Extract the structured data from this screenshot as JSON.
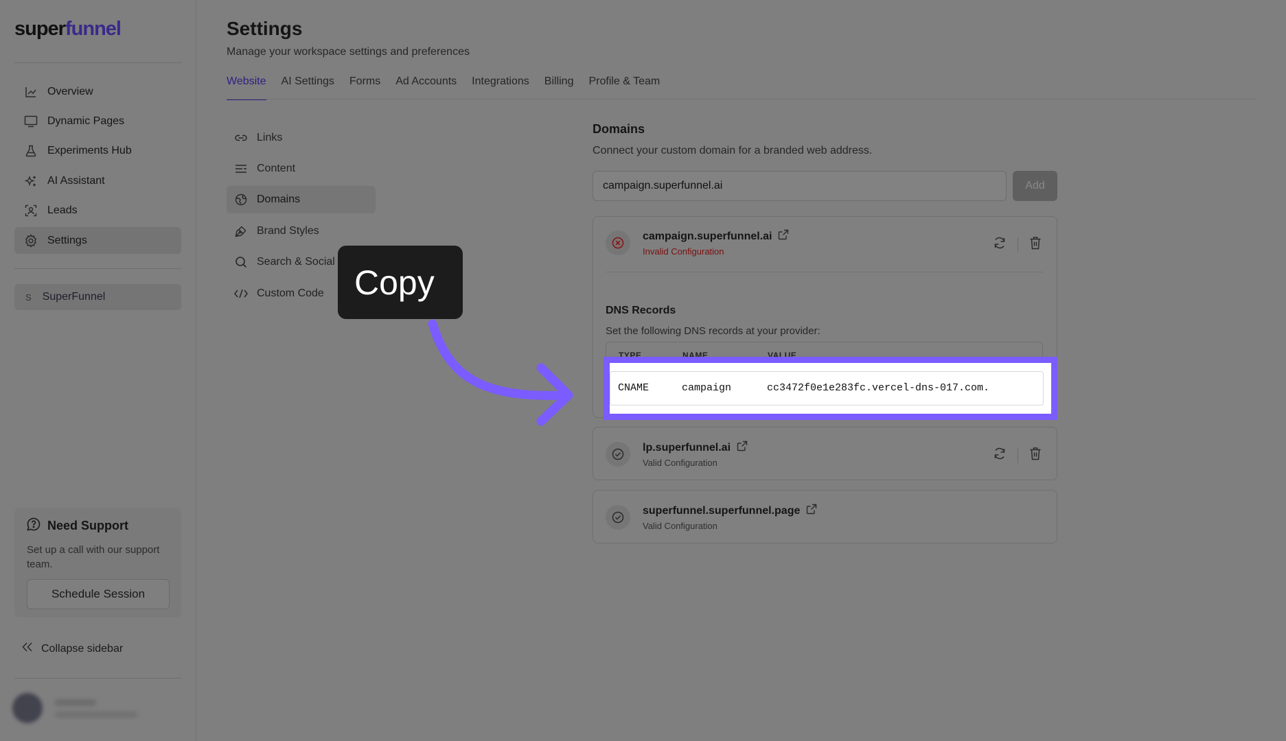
{
  "app": {
    "logo_left": "super",
    "logo_right": "funnel"
  },
  "sidebar": {
    "items": [
      {
        "label": "Overview",
        "icon": "chart-line-icon",
        "active": false
      },
      {
        "label": "Dynamic Pages",
        "icon": "monitor-icon",
        "active": false
      },
      {
        "label": "Experiments Hub",
        "icon": "flask-icon",
        "active": false
      },
      {
        "label": "AI Assistant",
        "icon": "sparkles-icon",
        "active": false
      },
      {
        "label": "Leads",
        "icon": "user-scan-icon",
        "active": false
      },
      {
        "label": "Settings",
        "icon": "gear-icon",
        "active": true
      }
    ],
    "workspace": {
      "letter": "S",
      "name": "SuperFunnel"
    },
    "support": {
      "title": "Need Support",
      "text": "Set up a call with our support team.",
      "button": "Schedule Session"
    },
    "collapse_label": "Collapse sidebar"
  },
  "header": {
    "title": "Settings",
    "subtitle": "Manage your workspace settings and preferences"
  },
  "tabs": [
    {
      "label": "Website",
      "active": true
    },
    {
      "label": "AI Settings",
      "active": false
    },
    {
      "label": "Forms",
      "active": false
    },
    {
      "label": "Ad Accounts",
      "active": false
    },
    {
      "label": "Integrations",
      "active": false
    },
    {
      "label": "Billing",
      "active": false
    },
    {
      "label": "Profile & Team",
      "active": false
    }
  ],
  "subnav": [
    {
      "label": "Links",
      "icon": "link-icon",
      "active": false
    },
    {
      "label": "Content",
      "icon": "text-lines-icon",
      "active": false
    },
    {
      "label": "Domains",
      "icon": "globe-icon",
      "active": true
    },
    {
      "label": "Brand Styles",
      "icon": "pen-tool-icon",
      "active": false
    },
    {
      "label": "Search & Social",
      "icon": "search-icon",
      "active": false
    },
    {
      "label": "Custom Code",
      "icon": "code-icon",
      "active": false
    }
  ],
  "domains": {
    "title": "Domains",
    "subtitle": "Connect your custom domain for a branded web address.",
    "input_value": "campaign.superfunnel.ai",
    "add_label": "Add",
    "list": [
      {
        "name": "campaign.superfunnel.ai",
        "status": "Invalid Configuration",
        "valid": false,
        "dns": {
          "title": "DNS Records",
          "subtitle": "Set the following DNS records at your provider:",
          "headers": [
            "TYPE",
            "NAME",
            "VALUE"
          ],
          "row": {
            "type": "CNAME",
            "name": "campaign",
            "value": "cc3472f0e1e283fc.vercel-dns-017.com."
          }
        }
      },
      {
        "name": "lp.superfunnel.ai",
        "status": "Valid Configuration",
        "valid": true
      },
      {
        "name": "superfunnel.superfunnel.page",
        "status": "Valid Configuration",
        "valid": true
      }
    ]
  },
  "annotation": {
    "tooltip": "Copy",
    "highlight_color": "#7b5cff",
    "arrow_color": "#7b5cff"
  }
}
